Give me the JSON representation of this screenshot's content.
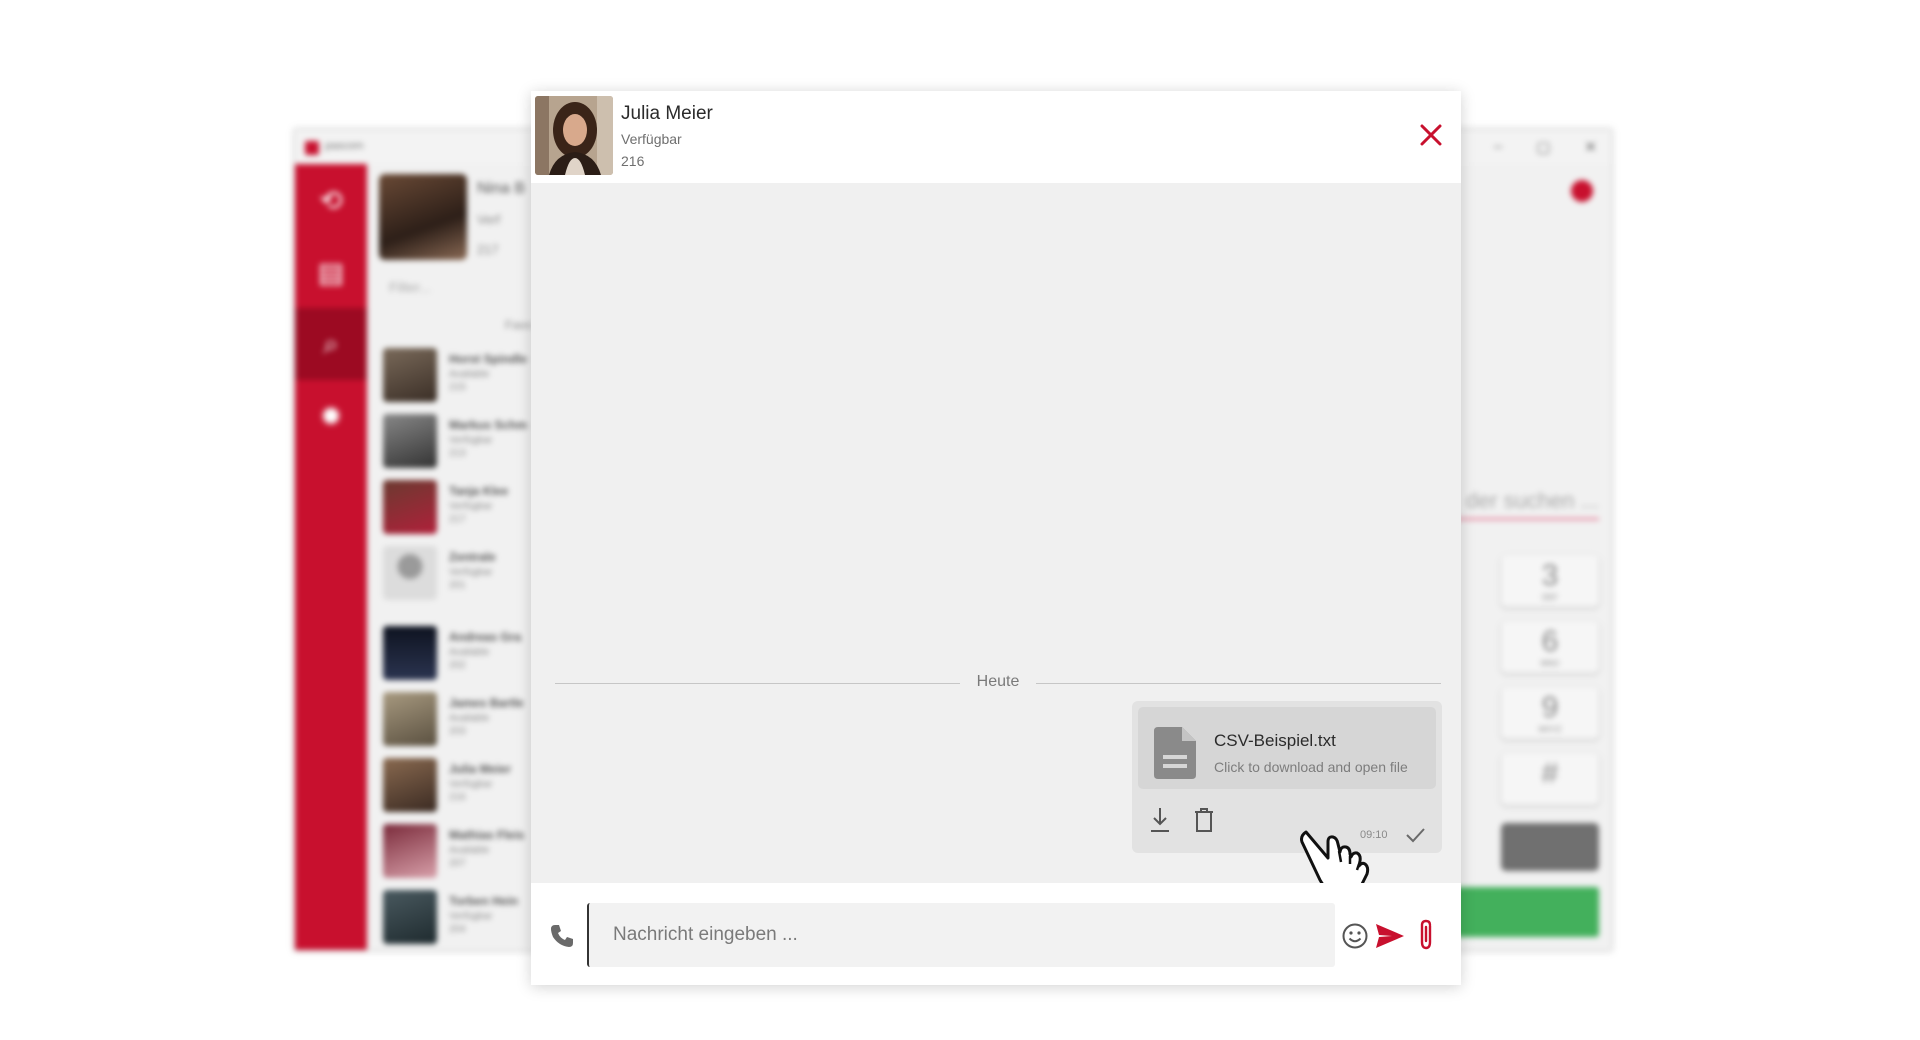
{
  "background_app": {
    "logo_text": "pascom",
    "window_buttons": [
      "–",
      "▢",
      "✕"
    ],
    "profile": {
      "name": "Nina B",
      "status": "Verf",
      "ext": "217"
    },
    "filter_placeholder": "Filter...",
    "section_label": "Favo",
    "contacts": [
      {
        "name": "Horst Spindle",
        "status": "Available",
        "ext": "215"
      },
      {
        "name": "Markus Schm",
        "status": "Verfügbar",
        "ext": "213"
      },
      {
        "name": "Tanja Klee",
        "status": "Verfügbar",
        "ext": "217"
      },
      {
        "name": "Zentrale",
        "status": "Verfügbar",
        "ext": "201"
      },
      {
        "name": "Andreas Gra",
        "status": "Available",
        "ext": "202"
      },
      {
        "name": "James Bartle",
        "status": "Available",
        "ext": "203"
      },
      {
        "name": "Julia Meier",
        "status": "Verfügbar",
        "ext": "216"
      },
      {
        "name": "Mathias Fleis",
        "status": "Available",
        "ext": "207"
      },
      {
        "name": "Torben Hein",
        "status": "Verfügbar",
        "ext": "204"
      }
    ],
    "dial_search_placeholder": "der suchen ...",
    "dial_keys": [
      {
        "digit": "3",
        "letters": "DEF"
      },
      {
        "digit": "6",
        "letters": "MNO"
      },
      {
        "digit": "9",
        "letters": "WXYZ"
      },
      {
        "digit": "#",
        "letters": ""
      }
    ]
  },
  "chat": {
    "contact_name": "Julia Meier",
    "contact_status": "Verfügbar",
    "contact_ext": "216",
    "date_divider": "Heute",
    "message": {
      "file_name": "CSV-Beispiel.txt",
      "file_hint": "Click to download and open file",
      "time": "09:10"
    },
    "input_placeholder": "Nachricht eingeben ..."
  },
  "colors": {
    "accent": "#c8102e",
    "rail": "#c8102e",
    "call_green": "#43b05c"
  }
}
